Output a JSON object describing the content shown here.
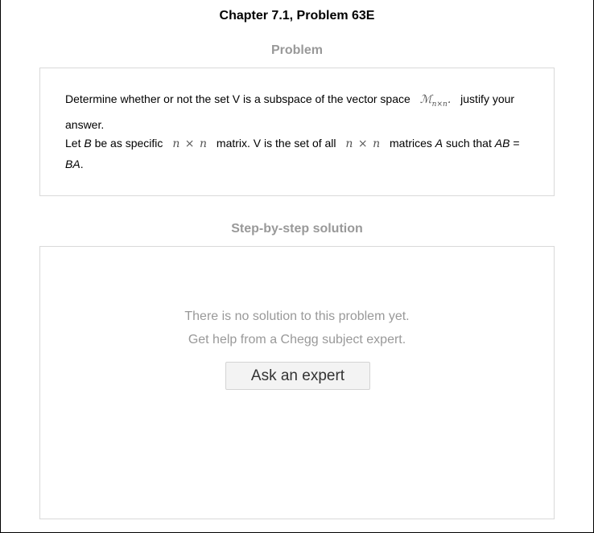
{
  "header": {
    "chapter_title": "Chapter 7.1, Problem 63E",
    "problem_heading": "Problem",
    "solution_heading": "Step-by-step solution"
  },
  "problem": {
    "p1_text": "Determine whether or not the set V is a subspace of the vector space",
    "p1_math_base": "ℳ",
    "p1_math_sub": "n×n",
    "p1_math_dot": ".",
    "p1_tail": "justify your answer.",
    "p2_start": "Let",
    "p2_B": "B",
    "p2_mid1": "be as specific",
    "p2_math1_a": "n",
    "p2_math1_times": "×",
    "p2_math1_b": "n",
    "p2_mid2": "matrix. V is the set of all",
    "p2_math2_a": "n",
    "p2_math2_times": "×",
    "p2_math2_b": "n",
    "p2_mid3": "matrices",
    "p2_A": "A",
    "p2_mid4": "such that",
    "p2_AB": "AB",
    "p2_eq": "=",
    "p2_BA": "BA",
    "p2_end": "."
  },
  "solution": {
    "no_solution_line1": "There is no solution to this problem yet.",
    "no_solution_line2": "Get help from a Chegg subject expert.",
    "ask_button_label": "Ask an expert"
  }
}
